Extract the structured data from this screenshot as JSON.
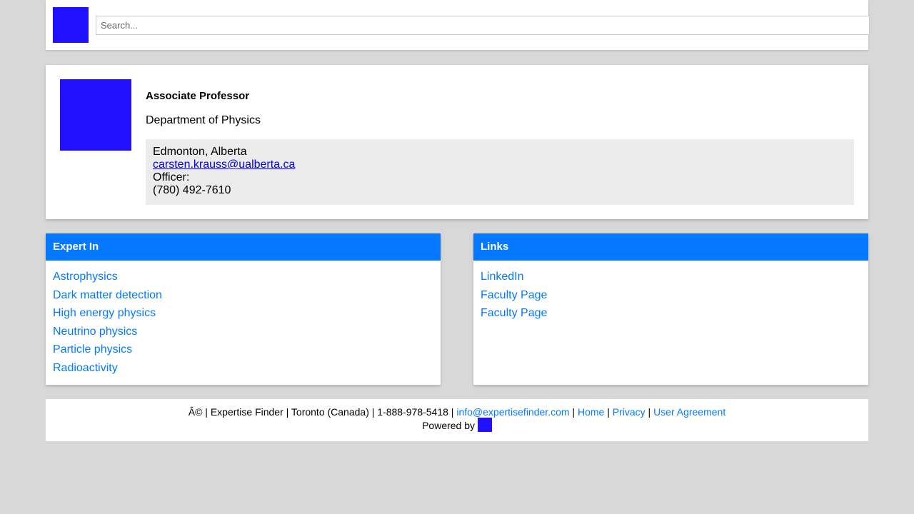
{
  "header": {
    "logo": "site-logo",
    "search": {
      "placeholder": "Search...",
      "value": ""
    }
  },
  "profile": {
    "photo": "profile-photo",
    "role": "Associate Professor",
    "department": "Department of Physics",
    "contact": {
      "location": "Edmonton, Alberta",
      "email": "carsten.krauss@ualberta.ca",
      "officer_label": "Officer:",
      "phone": "(780) 492-7610"
    }
  },
  "expert_in": {
    "heading": "Expert In",
    "items": [
      "Astrophysics",
      "Dark matter detection",
      "High energy physics",
      "Neutrino physics",
      "Particle physics",
      "Radioactivity"
    ]
  },
  "links": {
    "heading": "Links",
    "items": [
      "LinkedIn",
      "Faculty Page",
      "Faculty Page"
    ]
  },
  "footer": {
    "prefix": "Â© | Expertise Finder | Toronto (Canada) | 1-888-978-5418 | ",
    "email": "info@expertisefinder.com",
    "sep": " | ",
    "home": "Home",
    "privacy": "Privacy",
    "agreement": "User Agreement",
    "powered_by": "Powered by "
  },
  "colors": {
    "accent": "#0479ff",
    "logo": "#2010ff",
    "background": "#d8d8d8",
    "contact_bg": "#ececec"
  }
}
